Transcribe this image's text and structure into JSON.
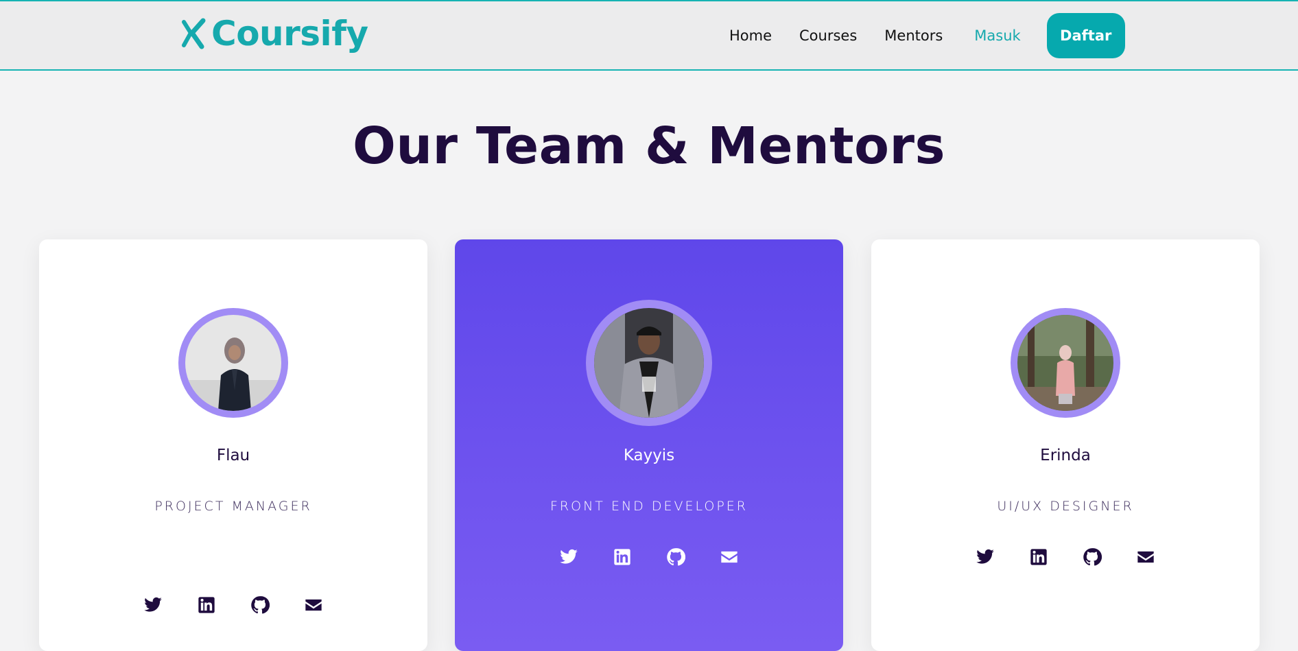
{
  "brand": {
    "name": "Coursify",
    "color": "#16a9ad"
  },
  "nav": {
    "items": [
      {
        "label": "Home"
      },
      {
        "label": "Courses"
      },
      {
        "label": "Mentors"
      },
      {
        "label": "Masuk"
      }
    ],
    "signup_label": "Daftar",
    "accent_color": "#06a9ae"
  },
  "page": {
    "title": "Our Team & Mentors"
  },
  "mentors": [
    {
      "name": "Flau",
      "role": "PROJECT MANAGER",
      "socials": [
        "twitter-icon",
        "linkedin-icon",
        "github-icon",
        "email-icon"
      ]
    },
    {
      "name": "Kayyis",
      "role": "FRONT END DEVELOPER",
      "socials": [
        "twitter-icon",
        "linkedin-icon",
        "github-icon",
        "email-icon"
      ],
      "highlight_color": "#5f47ea"
    },
    {
      "name": "Erinda",
      "role": "UI/UX DESIGNER",
      "socials": [
        "twitter-icon",
        "linkedin-icon",
        "github-icon",
        "email-icon"
      ]
    }
  ]
}
